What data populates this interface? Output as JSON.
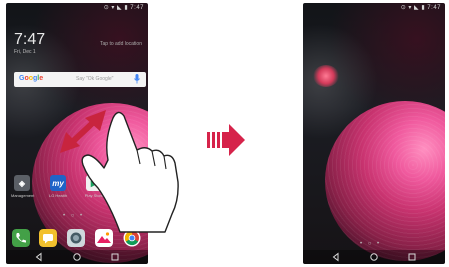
{
  "left_screen": {
    "status_text": "⊙ ▾ ◣ ▮ 7:47",
    "clock": "7:47",
    "date": "Fri, Dec 1",
    "weather": "Tap to add location",
    "search": {
      "logo": [
        "G",
        "o",
        "o",
        "g",
        "l",
        "e"
      ],
      "placeholder": "Say \"Ok Google\""
    },
    "apps": [
      {
        "name": "Management",
        "badge": "◈",
        "color": "#5b5f66"
      },
      {
        "name": "LG Health",
        "badge": "my",
        "color": "#1f63c7"
      },
      {
        "name": "Play Store",
        "badge": "▶",
        "color": "#f1f1f1"
      }
    ],
    "page_dots": "• ○ •",
    "dock": [
      {
        "name": "Phone",
        "color": "#43a047"
      },
      {
        "name": "Messaging",
        "color": "#f2c12e"
      },
      {
        "name": "Camera",
        "color": "#607d8b"
      },
      {
        "name": "Gallery",
        "color": "#ffffff"
      },
      {
        "name": "Chrome",
        "color": "#ffffff"
      }
    ]
  },
  "right_screen": {
    "status_text": "⊙ ▾ ◣ ▮ 7:47",
    "page_dots": "• ○ •"
  },
  "colors": {
    "arrow": "#d6234a",
    "gesture_arrows": "#c8243e"
  }
}
